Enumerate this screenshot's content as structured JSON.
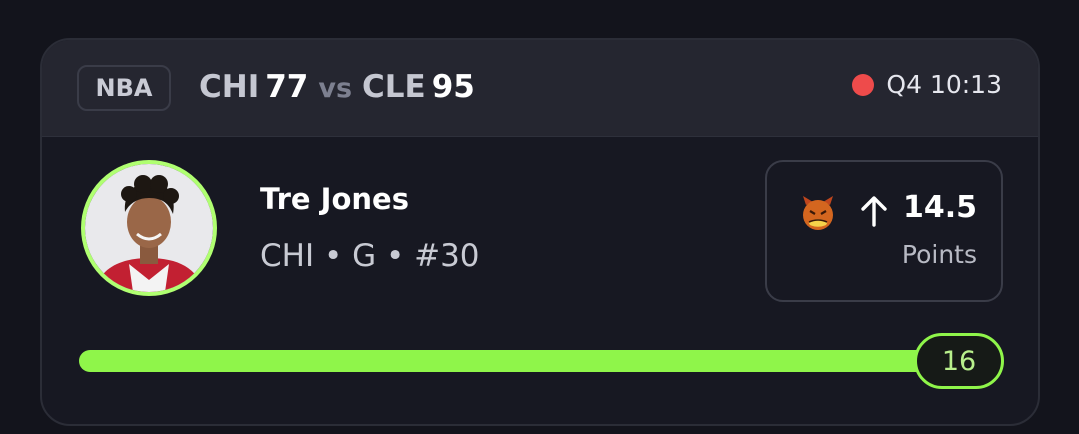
{
  "game": {
    "league": "NBA",
    "home_team": "CHI",
    "home_score": "77",
    "separator": "vs",
    "away_team": "CLE",
    "away_score": "95",
    "clock": "Q4 10:13"
  },
  "player": {
    "name": "Tre Jones",
    "meta": "CHI • G • #30"
  },
  "pick": {
    "icon": "devil-face-icon",
    "direction": "up-arrow-icon",
    "line": "14.5",
    "stat": "Points"
  },
  "progress": {
    "current": "16",
    "fraction": 1.0
  },
  "colors": {
    "accent": "#8ff54a",
    "live": "#ee4b4b",
    "background": "#13141c",
    "card": "#171822",
    "header": "#252630"
  }
}
